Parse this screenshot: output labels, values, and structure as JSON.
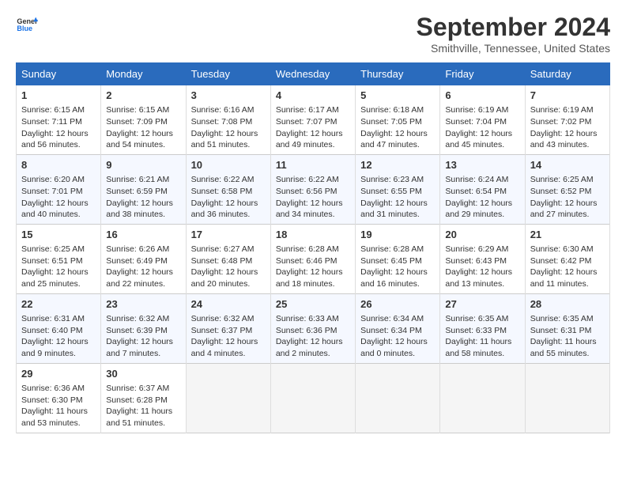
{
  "header": {
    "logo_general": "General",
    "logo_blue": "Blue",
    "title": "September 2024",
    "subtitle": "Smithville, Tennessee, United States"
  },
  "weekdays": [
    "Sunday",
    "Monday",
    "Tuesday",
    "Wednesday",
    "Thursday",
    "Friday",
    "Saturday"
  ],
  "weeks": [
    [
      {
        "day": "1",
        "sunrise": "Sunrise: 6:15 AM",
        "sunset": "Sunset: 7:11 PM",
        "daylight": "Daylight: 12 hours and 56 minutes."
      },
      {
        "day": "2",
        "sunrise": "Sunrise: 6:15 AM",
        "sunset": "Sunset: 7:09 PM",
        "daylight": "Daylight: 12 hours and 54 minutes."
      },
      {
        "day": "3",
        "sunrise": "Sunrise: 6:16 AM",
        "sunset": "Sunset: 7:08 PM",
        "daylight": "Daylight: 12 hours and 51 minutes."
      },
      {
        "day": "4",
        "sunrise": "Sunrise: 6:17 AM",
        "sunset": "Sunset: 7:07 PM",
        "daylight": "Daylight: 12 hours and 49 minutes."
      },
      {
        "day": "5",
        "sunrise": "Sunrise: 6:18 AM",
        "sunset": "Sunset: 7:05 PM",
        "daylight": "Daylight: 12 hours and 47 minutes."
      },
      {
        "day": "6",
        "sunrise": "Sunrise: 6:19 AM",
        "sunset": "Sunset: 7:04 PM",
        "daylight": "Daylight: 12 hours and 45 minutes."
      },
      {
        "day": "7",
        "sunrise": "Sunrise: 6:19 AM",
        "sunset": "Sunset: 7:02 PM",
        "daylight": "Daylight: 12 hours and 43 minutes."
      }
    ],
    [
      {
        "day": "8",
        "sunrise": "Sunrise: 6:20 AM",
        "sunset": "Sunset: 7:01 PM",
        "daylight": "Daylight: 12 hours and 40 minutes."
      },
      {
        "day": "9",
        "sunrise": "Sunrise: 6:21 AM",
        "sunset": "Sunset: 6:59 PM",
        "daylight": "Daylight: 12 hours and 38 minutes."
      },
      {
        "day": "10",
        "sunrise": "Sunrise: 6:22 AM",
        "sunset": "Sunset: 6:58 PM",
        "daylight": "Daylight: 12 hours and 36 minutes."
      },
      {
        "day": "11",
        "sunrise": "Sunrise: 6:22 AM",
        "sunset": "Sunset: 6:56 PM",
        "daylight": "Daylight: 12 hours and 34 minutes."
      },
      {
        "day": "12",
        "sunrise": "Sunrise: 6:23 AM",
        "sunset": "Sunset: 6:55 PM",
        "daylight": "Daylight: 12 hours and 31 minutes."
      },
      {
        "day": "13",
        "sunrise": "Sunrise: 6:24 AM",
        "sunset": "Sunset: 6:54 PM",
        "daylight": "Daylight: 12 hours and 29 minutes."
      },
      {
        "day": "14",
        "sunrise": "Sunrise: 6:25 AM",
        "sunset": "Sunset: 6:52 PM",
        "daylight": "Daylight: 12 hours and 27 minutes."
      }
    ],
    [
      {
        "day": "15",
        "sunrise": "Sunrise: 6:25 AM",
        "sunset": "Sunset: 6:51 PM",
        "daylight": "Daylight: 12 hours and 25 minutes."
      },
      {
        "day": "16",
        "sunrise": "Sunrise: 6:26 AM",
        "sunset": "Sunset: 6:49 PM",
        "daylight": "Daylight: 12 hours and 22 minutes."
      },
      {
        "day": "17",
        "sunrise": "Sunrise: 6:27 AM",
        "sunset": "Sunset: 6:48 PM",
        "daylight": "Daylight: 12 hours and 20 minutes."
      },
      {
        "day": "18",
        "sunrise": "Sunrise: 6:28 AM",
        "sunset": "Sunset: 6:46 PM",
        "daylight": "Daylight: 12 hours and 18 minutes."
      },
      {
        "day": "19",
        "sunrise": "Sunrise: 6:28 AM",
        "sunset": "Sunset: 6:45 PM",
        "daylight": "Daylight: 12 hours and 16 minutes."
      },
      {
        "day": "20",
        "sunrise": "Sunrise: 6:29 AM",
        "sunset": "Sunset: 6:43 PM",
        "daylight": "Daylight: 12 hours and 13 minutes."
      },
      {
        "day": "21",
        "sunrise": "Sunrise: 6:30 AM",
        "sunset": "Sunset: 6:42 PM",
        "daylight": "Daylight: 12 hours and 11 minutes."
      }
    ],
    [
      {
        "day": "22",
        "sunrise": "Sunrise: 6:31 AM",
        "sunset": "Sunset: 6:40 PM",
        "daylight": "Daylight: 12 hours and 9 minutes."
      },
      {
        "day": "23",
        "sunrise": "Sunrise: 6:32 AM",
        "sunset": "Sunset: 6:39 PM",
        "daylight": "Daylight: 12 hours and 7 minutes."
      },
      {
        "day": "24",
        "sunrise": "Sunrise: 6:32 AM",
        "sunset": "Sunset: 6:37 PM",
        "daylight": "Daylight: 12 hours and 4 minutes."
      },
      {
        "day": "25",
        "sunrise": "Sunrise: 6:33 AM",
        "sunset": "Sunset: 6:36 PM",
        "daylight": "Daylight: 12 hours and 2 minutes."
      },
      {
        "day": "26",
        "sunrise": "Sunrise: 6:34 AM",
        "sunset": "Sunset: 6:34 PM",
        "daylight": "Daylight: 12 hours and 0 minutes."
      },
      {
        "day": "27",
        "sunrise": "Sunrise: 6:35 AM",
        "sunset": "Sunset: 6:33 PM",
        "daylight": "Daylight: 11 hours and 58 minutes."
      },
      {
        "day": "28",
        "sunrise": "Sunrise: 6:35 AM",
        "sunset": "Sunset: 6:31 PM",
        "daylight": "Daylight: 11 hours and 55 minutes."
      }
    ],
    [
      {
        "day": "29",
        "sunrise": "Sunrise: 6:36 AM",
        "sunset": "Sunset: 6:30 PM",
        "daylight": "Daylight: 11 hours and 53 minutes."
      },
      {
        "day": "30",
        "sunrise": "Sunrise: 6:37 AM",
        "sunset": "Sunset: 6:28 PM",
        "daylight": "Daylight: 11 hours and 51 minutes."
      },
      {
        "day": "",
        "sunrise": "",
        "sunset": "",
        "daylight": ""
      },
      {
        "day": "",
        "sunrise": "",
        "sunset": "",
        "daylight": ""
      },
      {
        "day": "",
        "sunrise": "",
        "sunset": "",
        "daylight": ""
      },
      {
        "day": "",
        "sunrise": "",
        "sunset": "",
        "daylight": ""
      },
      {
        "day": "",
        "sunrise": "",
        "sunset": "",
        "daylight": ""
      }
    ]
  ]
}
